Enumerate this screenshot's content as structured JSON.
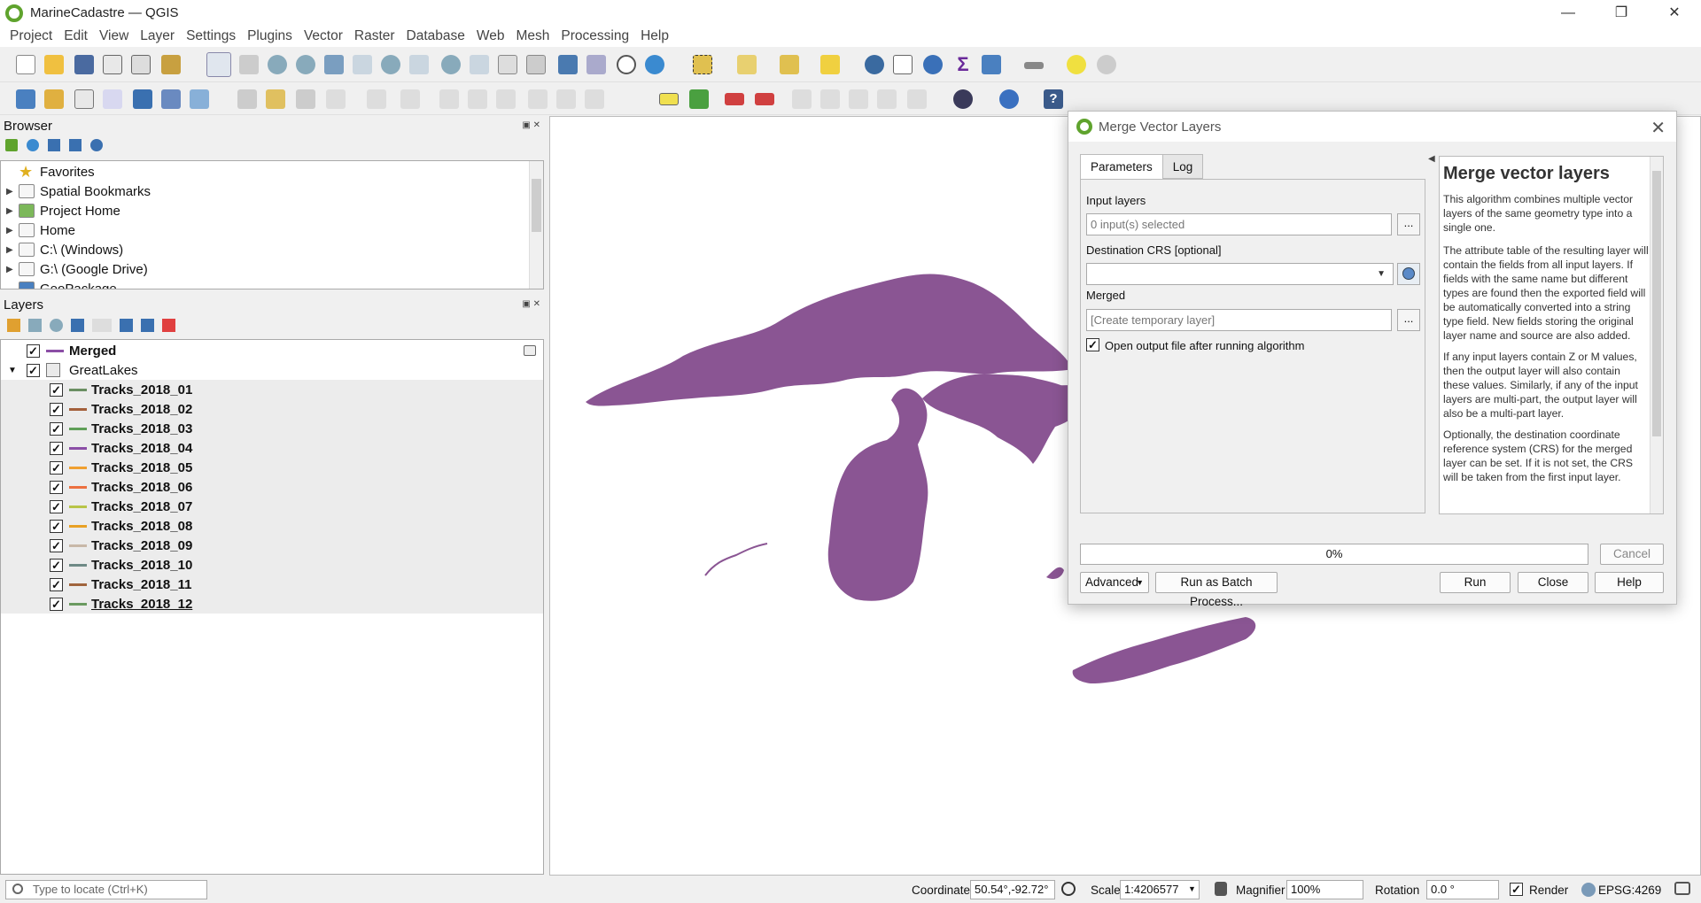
{
  "window": {
    "title": "MarineCadastre — QGIS",
    "minimize": "—",
    "restore": "❐",
    "close": "✕"
  },
  "menu": [
    "Project",
    "Edit",
    "View",
    "Layer",
    "Settings",
    "Plugins",
    "Vector",
    "Raster",
    "Database",
    "Web",
    "Mesh",
    "Processing",
    "Help"
  ],
  "browser": {
    "title": "Browser",
    "items": [
      "Favorites",
      "Spatial Bookmarks",
      "Project Home",
      "Home",
      "C:\\ (Windows)",
      "G:\\ (Google Drive)",
      "GeoPackage"
    ]
  },
  "layers": {
    "title": "Layers",
    "merged": "Merged",
    "group": "GreatLakes",
    "tracks": [
      {
        "name": "Tracks_2018_01",
        "color": "#6a8f62"
      },
      {
        "name": "Tracks_2018_02",
        "color": "#a4603b"
      },
      {
        "name": "Tracks_2018_03",
        "color": "#5f9f58"
      },
      {
        "name": "Tracks_2018_04",
        "color": "#8b4ea6"
      },
      {
        "name": "Tracks_2018_05",
        "color": "#f0a030"
      },
      {
        "name": "Tracks_2018_06",
        "color": "#ec7040"
      },
      {
        "name": "Tracks_2018_07",
        "color": "#b8c448"
      },
      {
        "name": "Tracks_2018_08",
        "color": "#e8a024"
      },
      {
        "name": "Tracks_2018_09",
        "color": "#c8b8a8"
      },
      {
        "name": "Tracks_2018_10",
        "color": "#6e8a86"
      },
      {
        "name": "Tracks_2018_11",
        "color": "#a0643c"
      },
      {
        "name": "Tracks_2018_12",
        "color": "#6a9a60"
      }
    ],
    "check": "✓"
  },
  "map": {
    "fill_color": "#8a5593"
  },
  "dialog": {
    "title": "Merge Vector Layers",
    "tabs": [
      "Parameters",
      "Log"
    ],
    "input_layers_label": "Input layers",
    "input_layers_value": "0 input(s) selected",
    "dest_crs_label": "Destination CRS [optional]",
    "merged_label": "Merged",
    "merged_placeholder": "[Create temporary layer]",
    "ellipsis": "...",
    "open_output_label": "Open output file after running algorithm",
    "help_title": "Merge vector layers",
    "help_p1": "This algorithm combines multiple vector layers of the same geometry type into a single one.",
    "help_p2": "The attribute table of the resulting layer will contain the fields from all input layers. If fields with the same name but different types are found then the exported field will be automatically converted into a string type field. New fields storing the original layer name and source are also added.",
    "help_p3": "If any input layers contain Z or M values, then the output layer will also contain these values. Similarly, if any of the input layers are multi-part, the output layer will also be a multi-part layer.",
    "help_p4": "Optionally, the destination coordinate reference system (CRS) for the merged layer can be set. If it is not set, the CRS will be taken from the first input layer.",
    "progress": "0%",
    "cancel": "Cancel",
    "advanced": "Advanced",
    "batch": "Run as Batch Process...",
    "run": "Run",
    "close": "Close",
    "help": "Help"
  },
  "status": {
    "locate_placeholder": "Type to locate (Ctrl+K)",
    "coordinate_label": "Coordinate",
    "coordinate_value": "50.54°,-92.72°",
    "scale_label": "Scale",
    "scale_value": "1:4206577",
    "magnifier_label": "Magnifier",
    "magnifier_value": "100%",
    "rotation_label": "Rotation",
    "rotation_value": "0.0 °",
    "render_label": "Render",
    "crs": "EPSG:4269"
  }
}
